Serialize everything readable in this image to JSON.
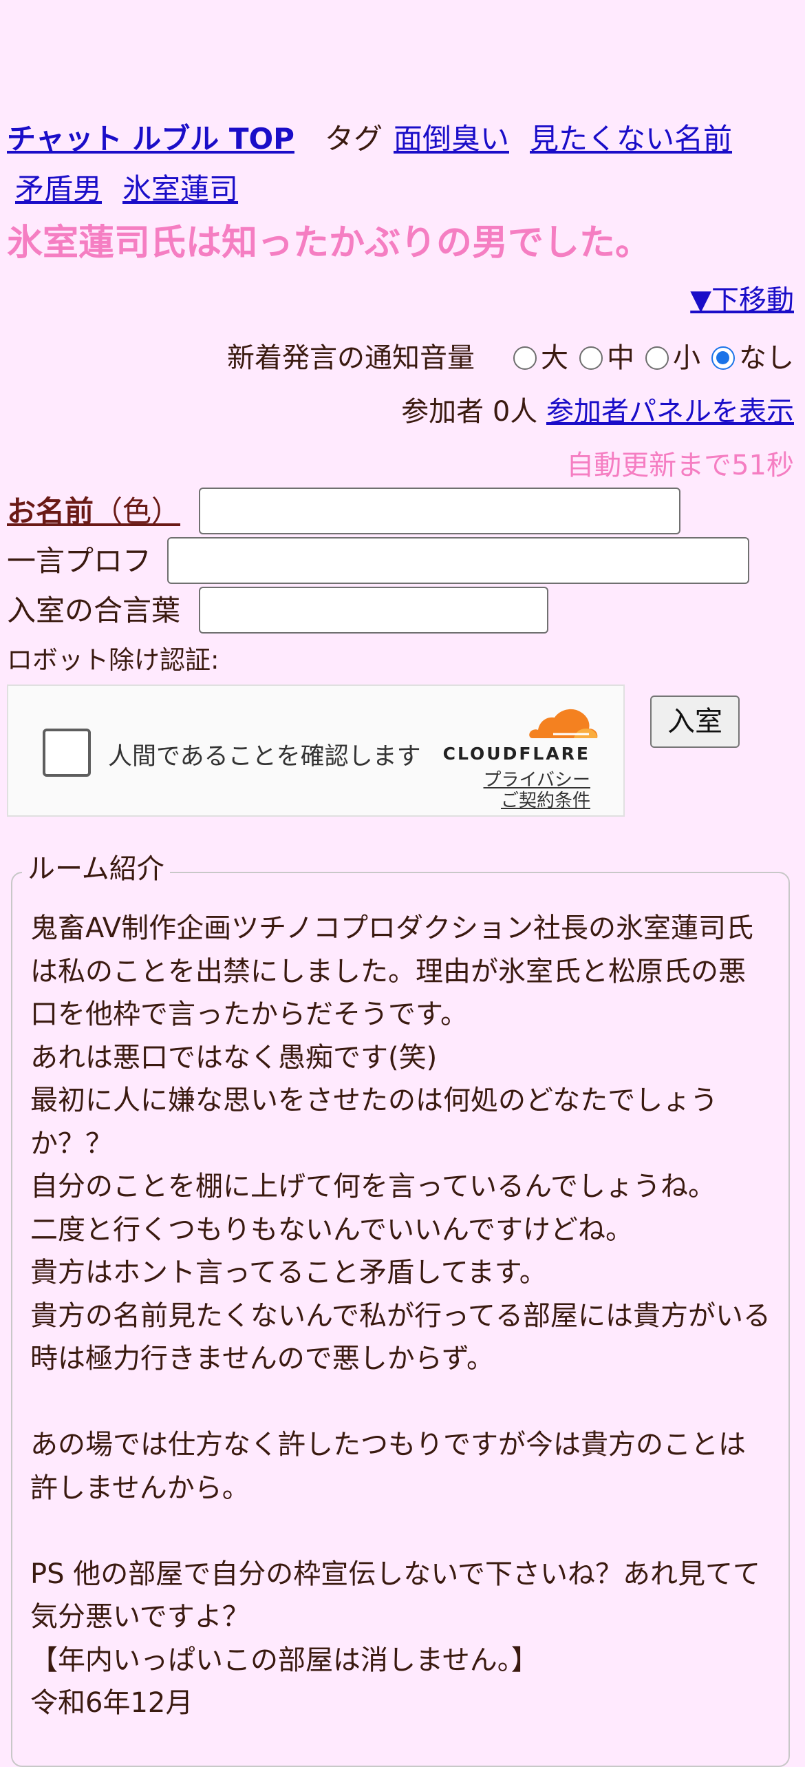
{
  "nav": {
    "top_link": "チャット ルブル TOP",
    "tag_label": "タグ",
    "tags": [
      "面倒臭い",
      "見たくない名前",
      "矛盾男",
      "氷室蓮司"
    ]
  },
  "title": "氷室蓮司氏は知ったかぶりの男でした。",
  "move_down": "▼下移動",
  "notify": {
    "label": "新着発言の通知音量",
    "options": [
      "大",
      "中",
      "小",
      "なし"
    ],
    "selected": "なし"
  },
  "participants": {
    "text": "参加者 0人",
    "panel_link": "参加者パネルを表示"
  },
  "auto_update": "自動更新まで51秒",
  "form": {
    "name_label": "お名前",
    "name_color": "（色）",
    "name_value": "",
    "profile_label": "一言プロフ",
    "profile_value": "",
    "password_label": "入室の合言葉",
    "password_value": "",
    "robot_label": "ロボット除け認証:",
    "enter_button": "入室"
  },
  "captcha": {
    "text": "人間であることを確認します",
    "brand": "CLOUDFLARE",
    "privacy": "プライバシー",
    "terms": "ご契約条件"
  },
  "room": {
    "legend": "ルーム紹介",
    "lines": [
      "鬼畜AV制作企画ツチノコプロダクション社長の氷室蓮司氏は私のことを出禁にしました。理由が氷室氏と松原氏の悪口を他枠で言ったからだそうです。",
      "あれは悪口ではなく愚痴です(笑)",
      "最初に人に嫌な思いをさせたのは何処のどなたでしょうか？？",
      "自分のことを棚に上げて何を言っているんでしょうね。",
      "二度と行くつもりもないんでいいんですけどね。",
      "貴方はホント言ってること矛盾してます。",
      "貴方の名前見たくないんで私が行ってる部屋には貴方がいる時は極力行きませんので悪しからず。",
      "",
      "あの場では仕方なく許したつもりですが今は貴方のことは許しませんから。",
      "",
      "PS 他の部屋で自分の枠宣伝しないで下さいね？あれ見てて気分悪いですよ？",
      "【年内いっぱいこの部屋は消しません。】",
      "令和6年12月"
    ]
  },
  "colors": {
    "background": "#ffeafe",
    "title": "#f57ec2",
    "link": "#1a0dc8",
    "text": "#3a1a10",
    "radio_checked": "#1a73e8",
    "cloudflare_orange": "#f48120"
  }
}
